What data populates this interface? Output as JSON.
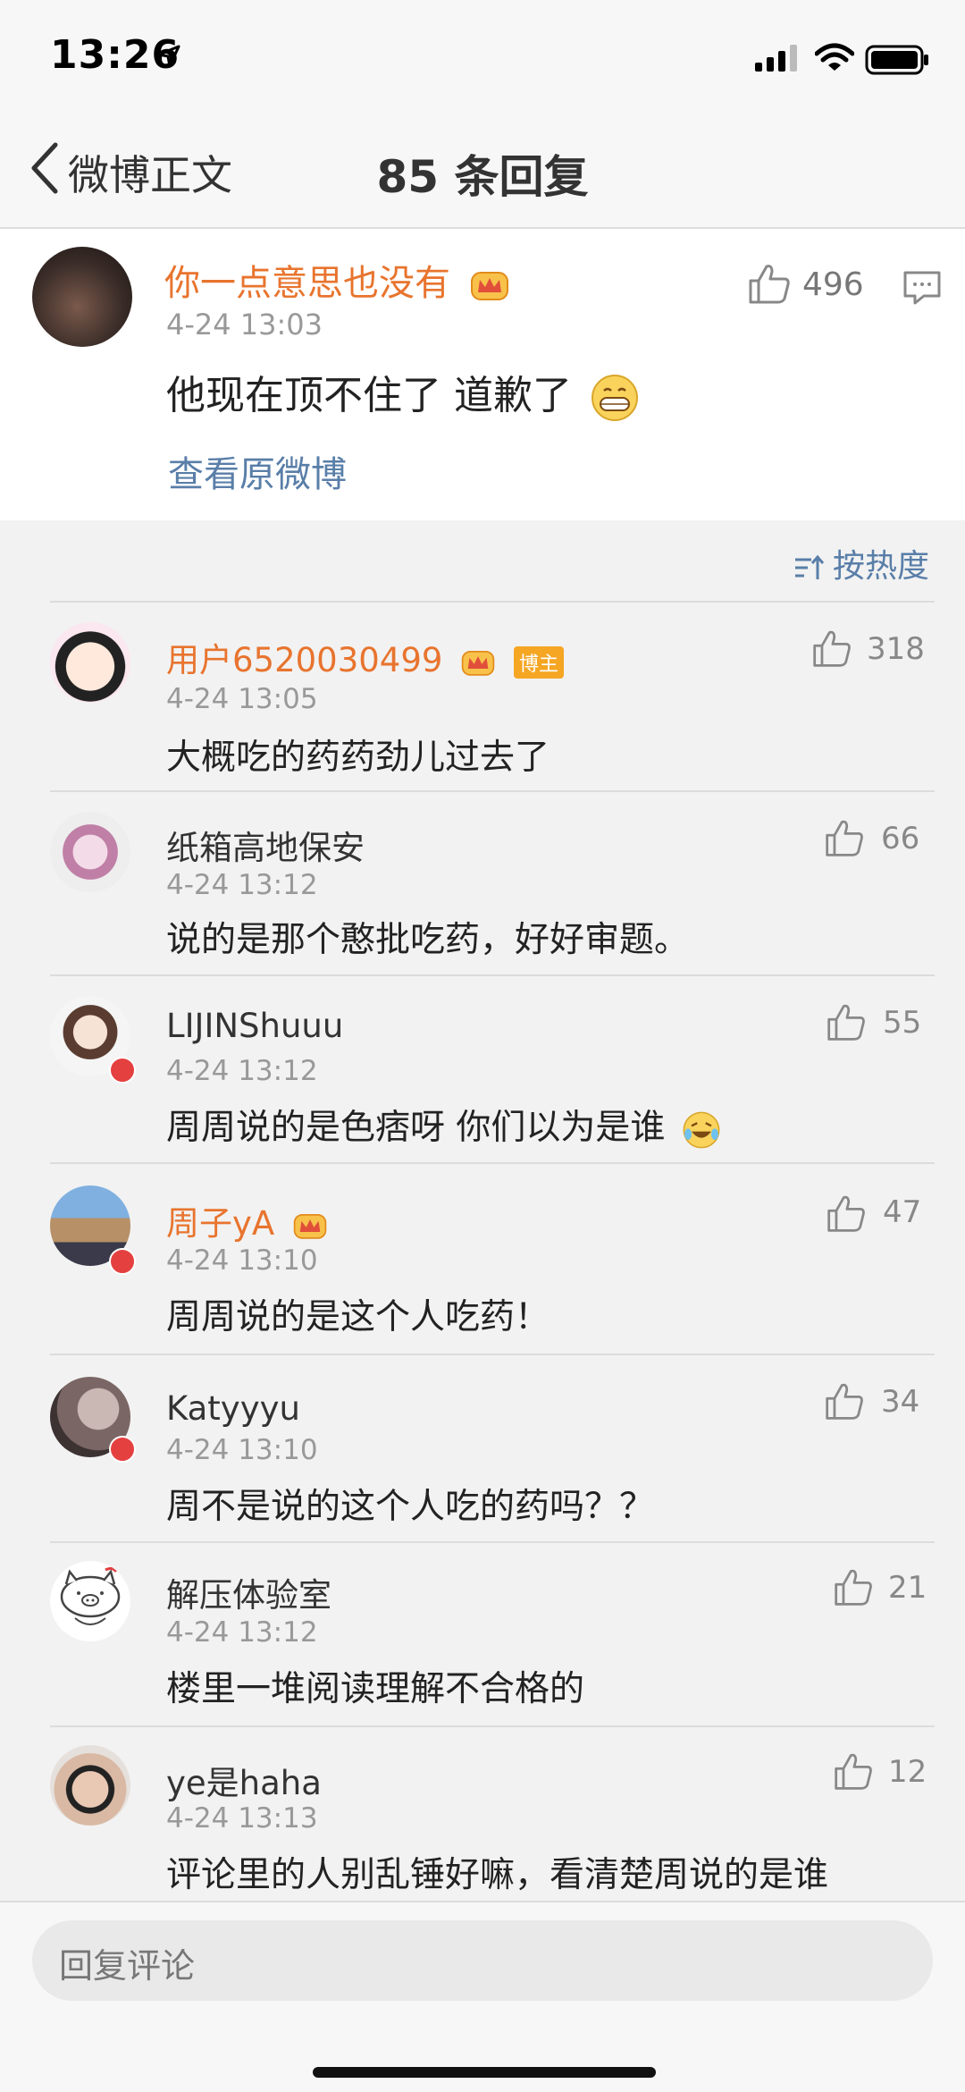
{
  "status_bar": {
    "time": "13:26"
  },
  "nav": {
    "back_label": "微博正文",
    "title": "85 条回复"
  },
  "original": {
    "author": "你一点意思也没有",
    "time": "4-24 13:03",
    "text": "他现在顶不住了 道歉了",
    "link": "查看原微博",
    "likes": "496"
  },
  "sort": {
    "label": "按热度"
  },
  "comments": [
    {
      "name": "用户6520030499",
      "badge": "博主",
      "time": "4-24 13:05",
      "text": "大概吃的药药劲儿过去了",
      "likes": "318"
    },
    {
      "name": "纸箱高地保安",
      "time": "4-24 13:12",
      "text": "说的是那个憨批吃药，好好审题。",
      "likes": "66"
    },
    {
      "name": "LIJINShuuu",
      "time": "4-24 13:12",
      "text": "周周说的是色痞呀 你们以为是谁",
      "likes": "55"
    },
    {
      "name": "周子yA",
      "time": "4-24 13:10",
      "text": "周周说的是这个人吃药！",
      "likes": "47"
    },
    {
      "name": "Katyyyu",
      "time": "4-24 13:10",
      "text": "周不是说的这个人吃的药吗？？",
      "likes": "34"
    },
    {
      "name": "解压体验室",
      "time": "4-24 13:12",
      "text": "楼里一堆阅读理解不合格的",
      "likes": "21"
    },
    {
      "name": "ye是haha",
      "time": "4-24 13:13",
      "text": "评论里的人别乱锤好嘛，看清楚周说的是谁",
      "likes": "12"
    }
  ],
  "input": {
    "placeholder": "回复评论"
  },
  "colors": {
    "vip_name": "#e8742e",
    "link": "#597ea8",
    "muted": "#999999"
  }
}
